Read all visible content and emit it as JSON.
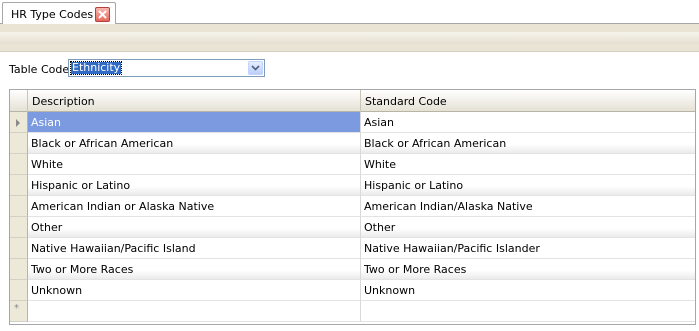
{
  "tab": {
    "title": "HR Type Codes",
    "close_icon": "close-icon"
  },
  "table_code": {
    "label": "Table Code",
    "value": "Ethnicity"
  },
  "grid": {
    "columns": [
      "Description",
      "Standard Code"
    ],
    "rows": [
      {
        "description": "Asian",
        "standard_code": "Asian"
      },
      {
        "description": "Black or African American",
        "standard_code": "Black or African American"
      },
      {
        "description": "White",
        "standard_code": "White"
      },
      {
        "description": "Hispanic or Latino",
        "standard_code": "Hispanic or Latino"
      },
      {
        "description": "American Indian or Alaska Native",
        "standard_code": "American Indian/Alaska Native"
      },
      {
        "description": "Other",
        "standard_code": "Other"
      },
      {
        "description": "Native Hawaiian/Pacific Island",
        "standard_code": "Native Hawaiian/Pacific Islander"
      },
      {
        "description": "Two or More Races",
        "standard_code": "Two or More Races"
      },
      {
        "description": "Unknown",
        "standard_code": "Unknown"
      }
    ],
    "new_row_marker": "*"
  },
  "colors": {
    "selection": "#316ac5",
    "active_row": "#7c9ae0",
    "toolbar_band": "#e9e4d4",
    "close_button": "#e8665a"
  }
}
